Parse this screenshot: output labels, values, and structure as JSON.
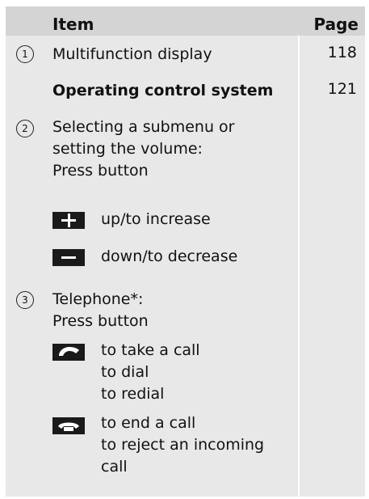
{
  "header": {
    "item": "Item",
    "page": "Page"
  },
  "rows": [
    {
      "num": "1",
      "text": "Multifunction display",
      "page": "118"
    },
    {
      "text": "Operating control system",
      "page": "121"
    },
    {
      "num": "2",
      "text_lines": [
        "Selecting a submenu or",
        "setting the volume:",
        "Press button"
      ]
    },
    {
      "icon": "plus-icon",
      "text": "up/to increase"
    },
    {
      "icon": "minus-icon",
      "text": "down/to decrease"
    },
    {
      "num": "3",
      "text_lines": [
        "Telephone*:",
        "Press button"
      ]
    },
    {
      "icon": "phone-call-icon",
      "text_lines": [
        "to take a call",
        "to dial",
        "to redial"
      ]
    },
    {
      "icon": "phone-end-icon",
      "text_lines": [
        "to end a call",
        "to reject an incoming",
        "call"
      ]
    }
  ]
}
